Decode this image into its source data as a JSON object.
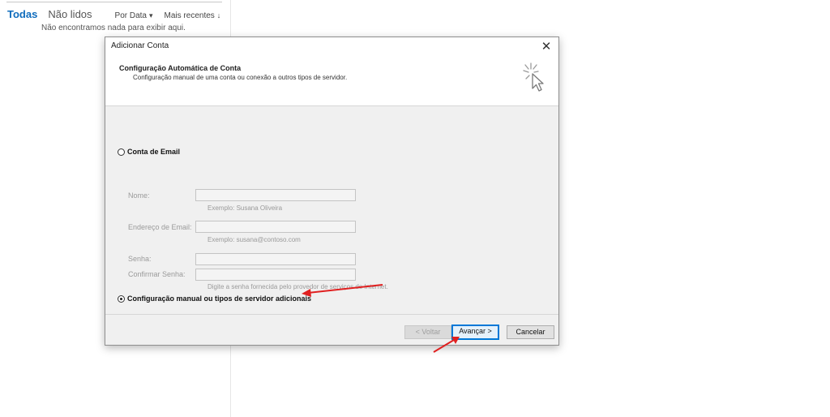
{
  "mail_list": {
    "tabs": [
      {
        "label": "Todas",
        "active": true
      },
      {
        "label": "Não lidos",
        "active": false
      }
    ],
    "sort_by_label": "Por Data",
    "sort_order_label": "Mais recentes",
    "empty_message": "Não encontramos nada para exibir aqui."
  },
  "dialog": {
    "title": "Adicionar Conta",
    "close_label": "✕",
    "header_title": "Configuração Automática de Conta",
    "header_subtitle": "Configuração manual de uma conta ou conexão a outros tipos de servidor.",
    "header_icon": "cursor-sparkle-icon",
    "option_email": {
      "label": "Conta de Email",
      "selected": false
    },
    "option_manual": {
      "label": "Configuração manual ou tipos de servidor adicionais",
      "selected": true
    },
    "fields": {
      "name": {
        "label": "Nome:",
        "value": "",
        "hint": "Exemplo: Susana Oliveira"
      },
      "email": {
        "label": "Endereço de Email:",
        "value": "",
        "hint": "Exemplo: susana@contoso.com"
      },
      "password": {
        "label": "Senha:",
        "value": ""
      },
      "confirm_password": {
        "label": "Confirmar Senha:",
        "value": "",
        "hint": "Digite a senha fornecida pelo provedor de serviços de Internet."
      }
    },
    "buttons": {
      "back": "< Voltar",
      "next": "Avançar >",
      "cancel": "Cancelar"
    }
  },
  "colors": {
    "accent": "#0f6cbd",
    "focus_border": "#0078d7",
    "annotation_arrow": "#e02020"
  }
}
